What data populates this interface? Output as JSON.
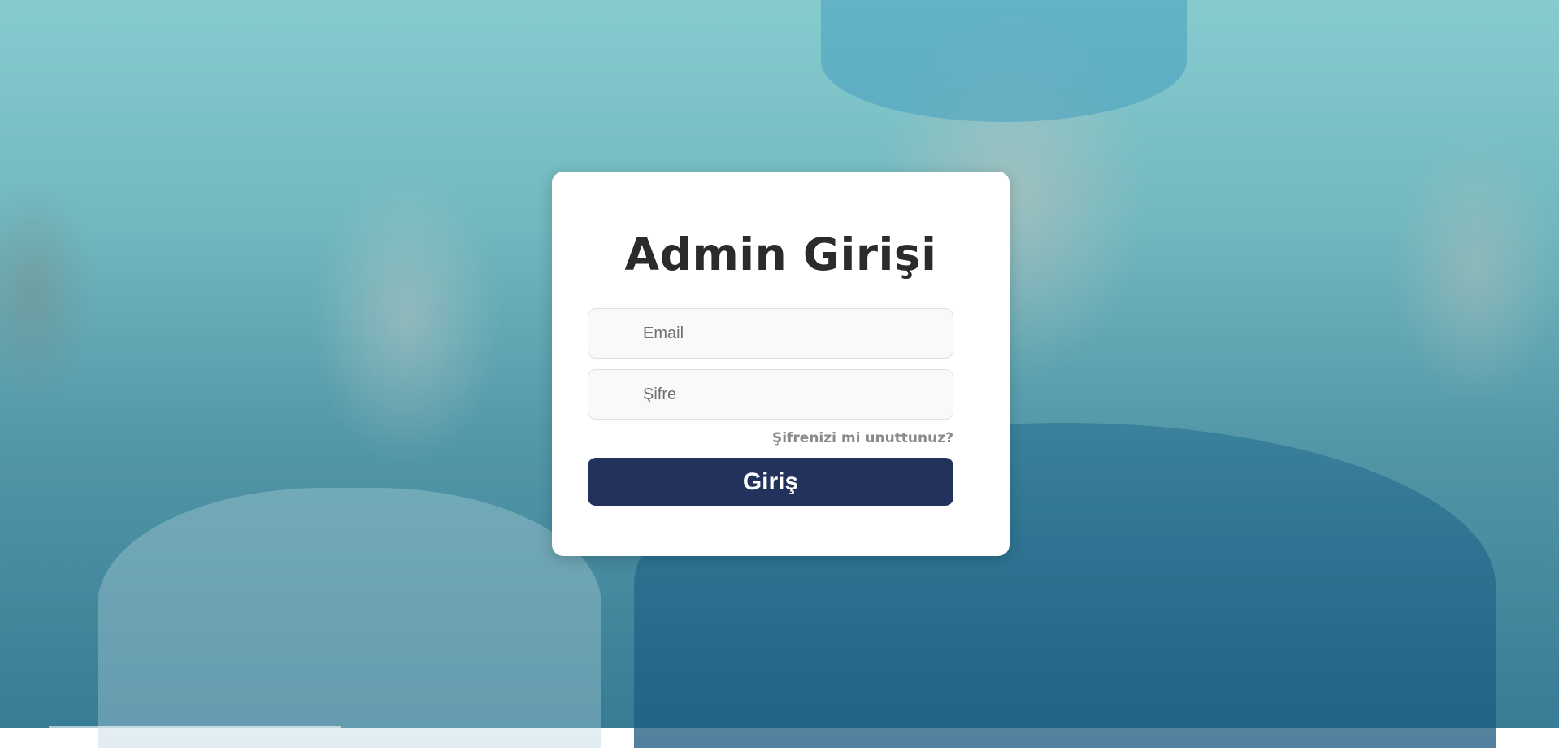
{
  "login": {
    "title": "Admin Girişi",
    "email_placeholder": "Email",
    "password_placeholder": "Şifre",
    "forgot_link": "Şifrenizi mi unuttunuz?",
    "submit_label": "Giriş"
  },
  "colors": {
    "button": "#22325c",
    "card": "#ffffff",
    "background_tint": "#86c9ce"
  }
}
